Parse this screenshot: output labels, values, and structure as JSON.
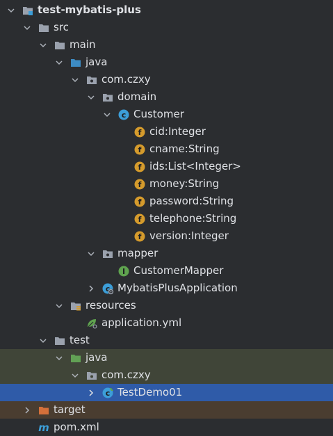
{
  "project": {
    "name": "test-mybatis-plus",
    "nodes": {
      "src": "src",
      "main": "main",
      "main_java": "java",
      "main_pkg": "com.czxy",
      "domain": "domain",
      "customer_class": "Customer",
      "fields": [
        "cid:Integer",
        "cname:String",
        "ids:List<Integer>",
        "money:String",
        "password:String",
        "telephone:String",
        "version:Integer"
      ],
      "mapper": "mapper",
      "customer_mapper": "CustomerMapper",
      "app_class": "MybatisPlusApplication",
      "resources": "resources",
      "app_yml": "application.yml",
      "test": "test",
      "test_java": "java",
      "test_pkg": "com.czxy",
      "test_class": "TestDemo01",
      "target": "target",
      "pom": "pom.xml"
    }
  },
  "colors": {
    "folder": "#9aa1ad",
    "source_folder": "#3d8cc4",
    "test_source_folder": "#62a155",
    "excluded_folder": "#d4703a",
    "class_icon": "#3c9ed8",
    "field_icon": "#d59b2c",
    "interface_icon": "#5fa34f",
    "selected_row": "#2f5ba8",
    "test_row": "#404538",
    "target_row": "#4a3d30"
  }
}
